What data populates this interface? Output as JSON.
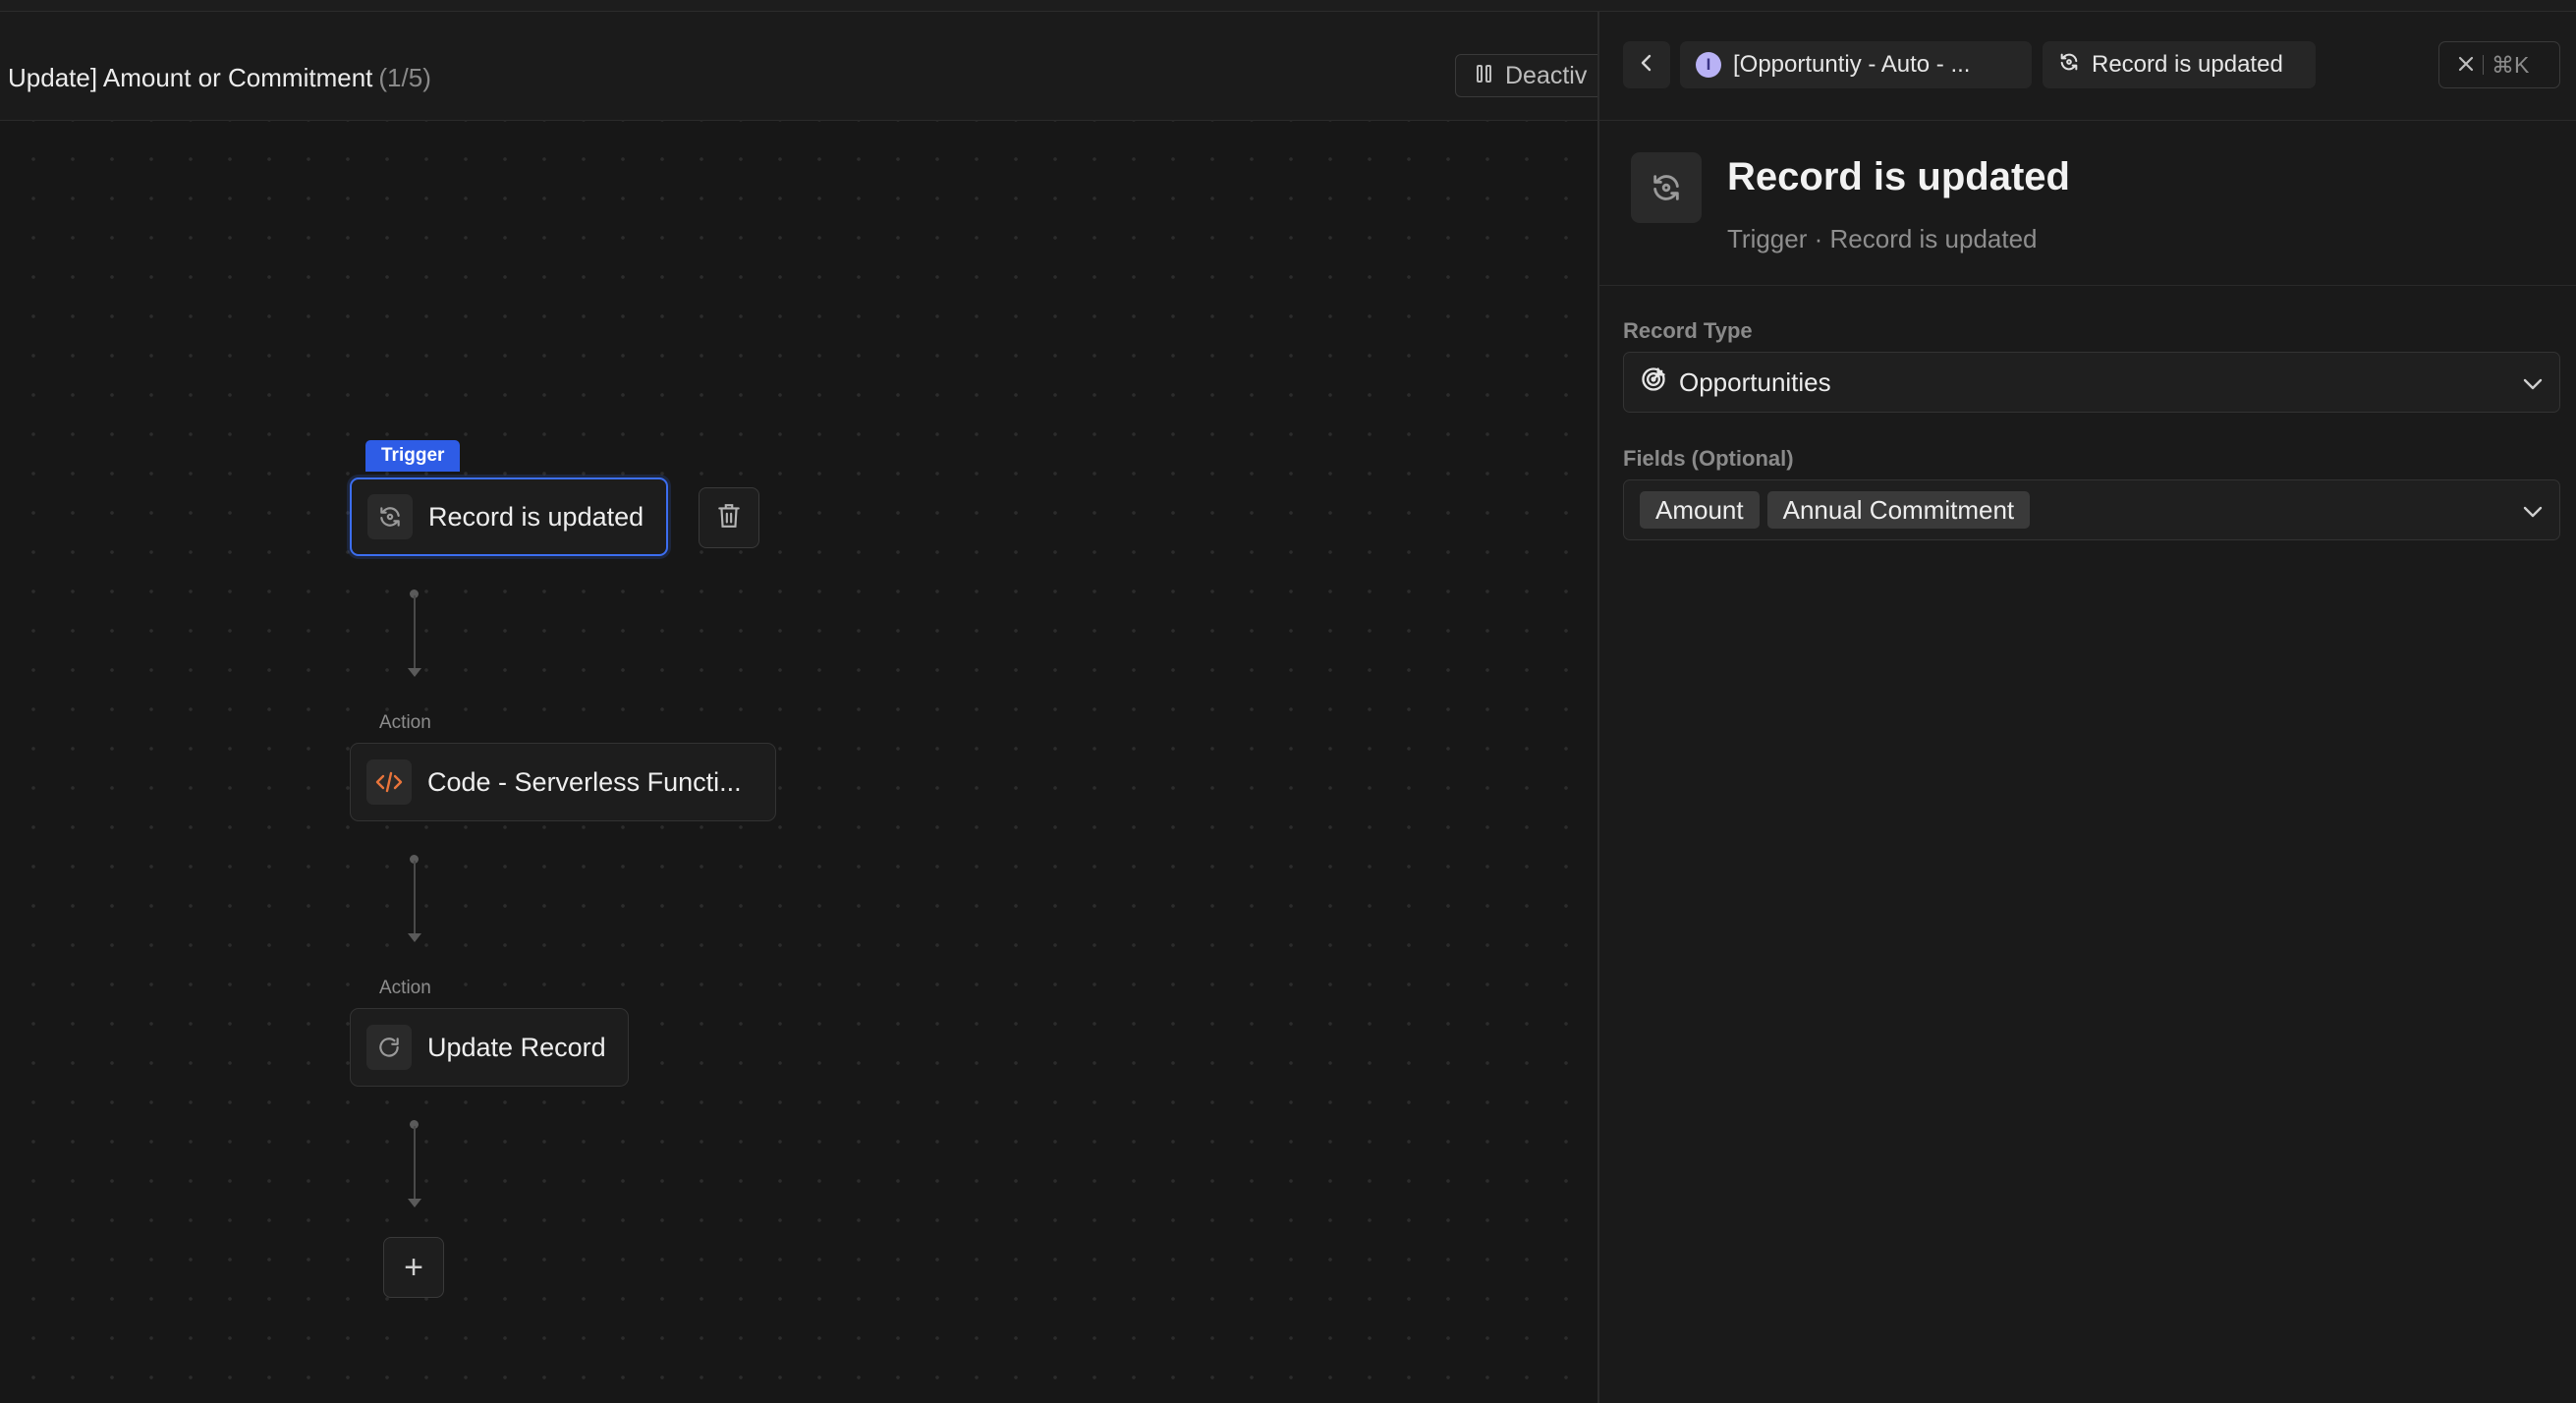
{
  "workflow": {
    "title": "Update] Amount or Commitment",
    "count": "(1/5)",
    "deactivate_label": "Deactiv"
  },
  "canvas": {
    "nodes": [
      {
        "tag": "Trigger",
        "label": "Record is updated",
        "icon": "refresh-icon"
      },
      {
        "tag": "Action",
        "label": "Code - Serverless Functi...",
        "icon": "code-icon"
      },
      {
        "tag": "Action",
        "label": "Update Record",
        "icon": "rotate-icon"
      }
    ],
    "add_label": "+"
  },
  "panel": {
    "breadcrumb_workflow": "[Opportuntiy - Auto - ...",
    "breadcrumb_workflow_avatar": "I",
    "breadcrumb_step": "Record is updated",
    "close_shortcut": "⌘K",
    "title": "Record is updated",
    "subtitle": "Trigger · Record is updated",
    "record_type_label": "Record Type",
    "record_type_value": "Opportunities",
    "fields_label": "Fields (Optional)",
    "fields_values": [
      "Amount",
      "Annual Commitment"
    ]
  },
  "colors": {
    "accent": "#3c6ef0",
    "trigger_tag": "#2e5ce6",
    "code_icon": "#e8743b",
    "avatar": "#b9b2f5"
  }
}
